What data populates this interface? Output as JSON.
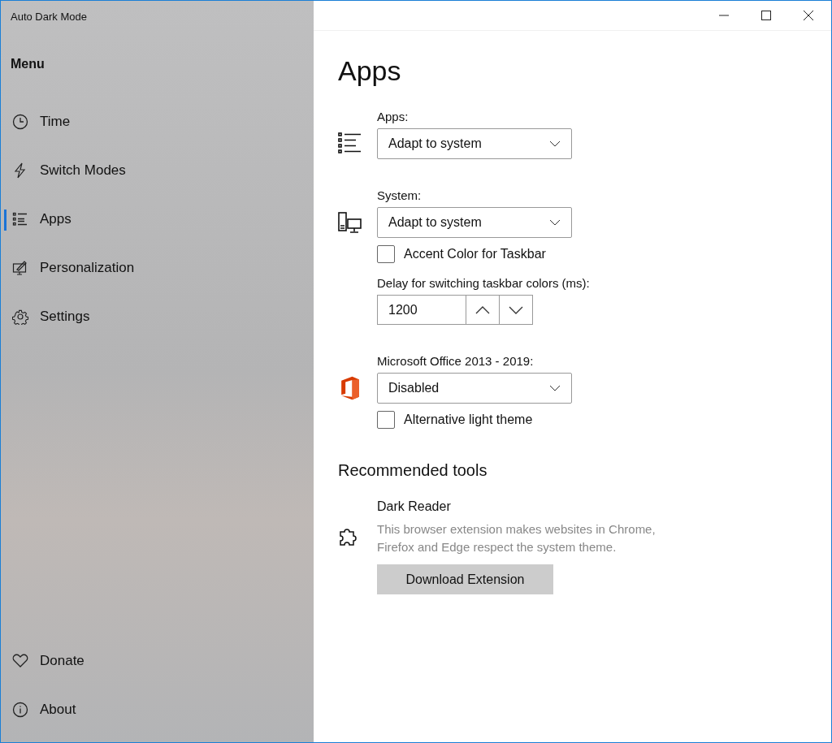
{
  "window": {
    "title": "Auto Dark Mode"
  },
  "sidebar": {
    "heading": "Menu",
    "items": [
      {
        "label": "Time",
        "selected": false
      },
      {
        "label": "Switch Modes",
        "selected": false
      },
      {
        "label": "Apps",
        "selected": true
      },
      {
        "label": "Personalization",
        "selected": false
      },
      {
        "label": "Settings",
        "selected": false
      }
    ],
    "footer_items": [
      {
        "label": "Donate",
        "selected": false
      },
      {
        "label": "About",
        "selected": false
      }
    ]
  },
  "page": {
    "title": "Apps",
    "sections": [
      {
        "label": "Apps:",
        "dropdown": {
          "value": "Adapt to system"
        }
      },
      {
        "label": "System:",
        "dropdown": {
          "value": "Adapt to system"
        },
        "checkbox": {
          "label": "Accent Color for Taskbar",
          "checked": false
        },
        "spinner": {
          "label": "Delay for switching taskbar colors (ms):",
          "value": "1200"
        }
      },
      {
        "label": "Microsoft Office 2013 - 2019:",
        "dropdown": {
          "value": "Disabled"
        },
        "checkbox": {
          "label": "Alternative light theme",
          "checked": false
        }
      }
    ],
    "recommended": {
      "heading": "Recommended tools",
      "tools": [
        {
          "name": "Dark Reader",
          "description": "This browser extension makes websites in Chrome, Firefox and Edge respect the system theme.",
          "button": "Download Extension"
        }
      ]
    }
  }
}
